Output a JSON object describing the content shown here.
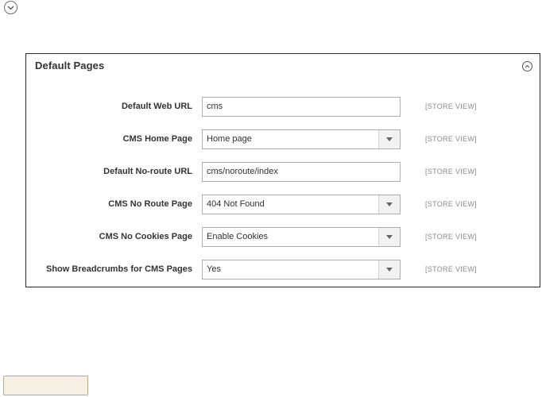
{
  "panel": {
    "title": "Default Pages"
  },
  "fields": [
    {
      "label": "Default Web URL",
      "value": "cms",
      "type": "text",
      "scope": "[STORE VIEW]"
    },
    {
      "label": "CMS Home Page",
      "value": "Home page",
      "type": "select",
      "scope": "[STORE VIEW]"
    },
    {
      "label": "Default No-route URL",
      "value": "cms/noroute/index",
      "type": "text",
      "scope": "[STORE VIEW]"
    },
    {
      "label": "CMS No Route Page",
      "value": "404 Not Found",
      "type": "select",
      "scope": "[STORE VIEW]"
    },
    {
      "label": "CMS No Cookies Page",
      "value": "Enable Cookies",
      "type": "select",
      "scope": "[STORE VIEW]"
    },
    {
      "label": "Show Breadcrumbs for CMS Pages",
      "value": "Yes",
      "type": "select",
      "scope": "[STORE VIEW]"
    }
  ],
  "icons": {
    "top_toggle": "chevron-down-icon",
    "panel_collapse": "chevron-up-icon",
    "select_arrow": "caret-down-icon"
  },
  "colors": {
    "panel_border": "#2b2b2b",
    "field_border": "#adadad",
    "scope_text": "#8a8a8a",
    "button_background": "#f6f1e4"
  }
}
